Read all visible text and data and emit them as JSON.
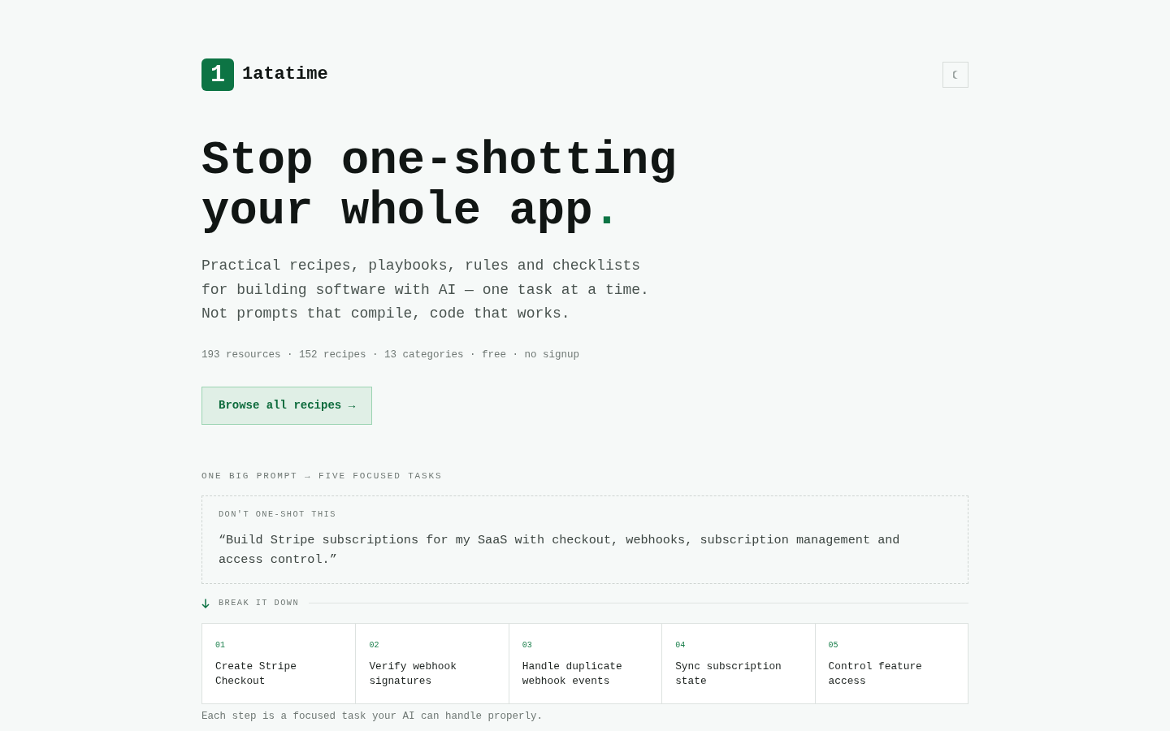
{
  "header": {
    "logo_mark": "1",
    "brand": "1atatime"
  },
  "hero": {
    "title": "Stop one-shotting your whole app",
    "accent": ".",
    "description": "Practical recipes, playbooks, rules and checklists for building software with AI — one task at a time. Not prompts that compile, code that works.",
    "stats": "193 resources · 152 recipes · 13 categories · free · no signup",
    "cta": "Browse all recipes →"
  },
  "section": {
    "label": "ONE BIG PROMPT → FIVE FOCUSED TASKS",
    "prompt_card": {
      "label": "DON'T ONE-SHOT THIS",
      "quote": "“Build Stripe subscriptions for my SaaS with checkout, webhooks, subscription management and access control.”"
    },
    "breakdown_label": "BREAK IT DOWN",
    "steps": [
      {
        "number": "01",
        "title": "Create Stripe Checkout"
      },
      {
        "number": "02",
        "title": "Verify webhook signatures"
      },
      {
        "number": "03",
        "title": "Handle duplicate webhook events"
      },
      {
        "number": "04",
        "title": "Sync subscription state"
      },
      {
        "number": "05",
        "title": "Control feature access"
      }
    ],
    "footnote": "Each step is a focused task your AI can handle properly."
  }
}
